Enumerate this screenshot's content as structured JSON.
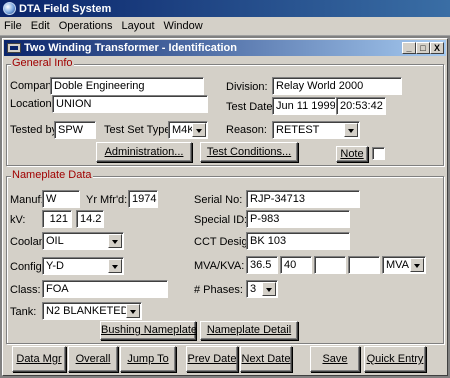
{
  "app": {
    "title": "DTA Field System"
  },
  "menu": [
    "File",
    "Edit",
    "Operations",
    "Layout",
    "Window"
  ],
  "window": {
    "title": "Two Winding Transformer - Identification",
    "controls": [
      "_",
      "□",
      "X"
    ]
  },
  "general": {
    "legend": "General Info",
    "company_label": "Company:",
    "company": "Doble Engineering",
    "location_label": "Location:",
    "location": "UNION",
    "tested_by_label": "Tested by:",
    "tested_by": "SPW",
    "test_set_type_label": "Test Set Type:",
    "test_set_type": "M4K",
    "division_label": "Division:",
    "division": "Relay World 2000",
    "test_date_label": "Test Date:",
    "test_date": "Jun 11 1999",
    "test_time": "20:53:42",
    "reason_label": "Reason:",
    "reason": "RETEST",
    "administration_button": "Administration...",
    "test_conditions_button": "Test Conditions...",
    "note_button": "Note"
  },
  "nameplate": {
    "legend": "Nameplate Data",
    "manuf_label": "Manuf:",
    "manuf": "W",
    "yr_mfd_label": "Yr Mfr'd:",
    "yr_mfd": "1974",
    "kv_label": "kV:",
    "kv_1": "121",
    "kv_2": "14.2",
    "coolant_label": "Coolant:",
    "coolant": "OIL",
    "config_label": "Config:",
    "config": "Y-D",
    "class_label": "Class:",
    "class": "FOA",
    "tank_label": "Tank:",
    "tank": "N2 BLANKETED",
    "serial_label": "Serial No:",
    "serial": "RJP-34713",
    "special_id_label": "Special ID:",
    "special_id": "P-983",
    "cct_desig_label": "CCT Desig:",
    "cct_desig": "BK 103",
    "mva_label": "MVA/KVA:",
    "mva_1": "36.5",
    "mva_2": "40",
    "mva_3": "",
    "mva_4": "",
    "mva_unit": "MVA",
    "phases_label": "# Phases:",
    "phases": "3",
    "bushing_button": "Bushing Nameplate",
    "nameplate_detail_button": "Nameplate Detail"
  },
  "footer": {
    "data_mgr": "Data Mgr",
    "overall": "Overall",
    "jump_to": "Jump To",
    "prev_date": "Prev Date",
    "next_date": "Next Date",
    "save": "Save",
    "quick_entry": "Quick Entry"
  }
}
